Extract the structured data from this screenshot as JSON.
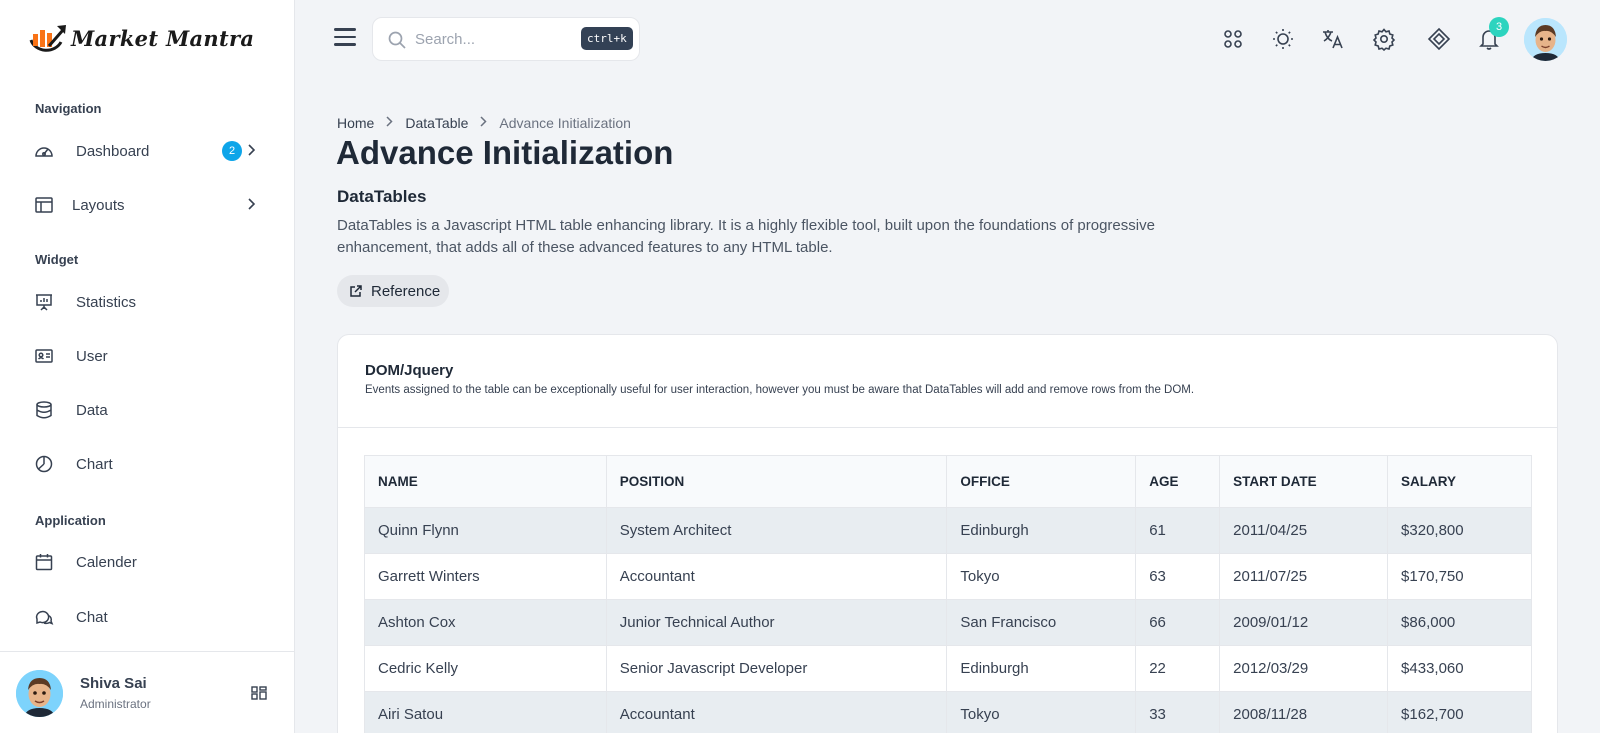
{
  "app": {
    "name": "Market Mantra"
  },
  "sidebar": {
    "sections": [
      {
        "label": "Navigation"
      },
      {
        "label": "Widget"
      },
      {
        "label": "Application"
      }
    ],
    "items": [
      {
        "label": "Dashboard",
        "icon": "gauge-icon",
        "badge": "2"
      },
      {
        "label": "Layouts",
        "icon": "layout-icon"
      },
      {
        "label": "Statistics",
        "icon": "presentation-icon"
      },
      {
        "label": "User",
        "icon": "id-card-icon"
      },
      {
        "label": "Data",
        "icon": "database-icon"
      },
      {
        "label": "Chart",
        "icon": "pie-chart-icon"
      },
      {
        "label": "Calender",
        "icon": "calendar-icon"
      },
      {
        "label": "Chat",
        "icon": "chat-icon"
      }
    ],
    "user": {
      "name": "Shiva Sai",
      "role": "Administrator"
    }
  },
  "header": {
    "search": {
      "placeholder": "Search...",
      "shortcut": "ctrl+k"
    },
    "notifications_count": "3",
    "icons": [
      "apps-icon",
      "sun-icon",
      "translate-icon",
      "settings-icon",
      "diamond-icon",
      "bell-icon"
    ]
  },
  "main": {
    "breadcrumb": {
      "home": "Home",
      "parent": "DataTable",
      "current": "Advance Initialization"
    },
    "title": "Advance Initialization",
    "subtitle": "DataTables",
    "description": "DataTables is a Javascript HTML table enhancing library. It is a highly flexible tool, built upon the foundations of progressive enhancement, that adds all of these advanced features to any HTML table.",
    "reference_label": "Reference",
    "card": {
      "title": "DOM/Jquery",
      "subtitle": "Events assigned to the table can be exceptionally useful for user interaction, however you must be aware that DataTables will add and remove rows from the DOM.",
      "columns": [
        "NAME",
        "POSITION",
        "OFFICE",
        "AGE",
        "START DATE",
        "SALARY"
      ],
      "rows": [
        [
          "Quinn Flynn",
          "System Architect",
          "Edinburgh",
          "61",
          "2011/04/25",
          "$320,800"
        ],
        [
          "Garrett Winters",
          "Accountant",
          "Tokyo",
          "63",
          "2011/07/25",
          "$170,750"
        ],
        [
          "Ashton Cox",
          "Junior Technical Author",
          "San Francisco",
          "66",
          "2009/01/12",
          "$86,000"
        ],
        [
          "Cedric Kelly",
          "Senior Javascript Developer",
          "Edinburgh",
          "22",
          "2012/03/29",
          "$433,060"
        ],
        [
          "Airi Satou",
          "Accountant",
          "Tokyo",
          "33",
          "2008/11/28",
          "$162,700"
        ]
      ]
    }
  },
  "colors": {
    "brand": "#f97316",
    "accent": "#0ea5e9",
    "notification": "#2dd4bf"
  }
}
